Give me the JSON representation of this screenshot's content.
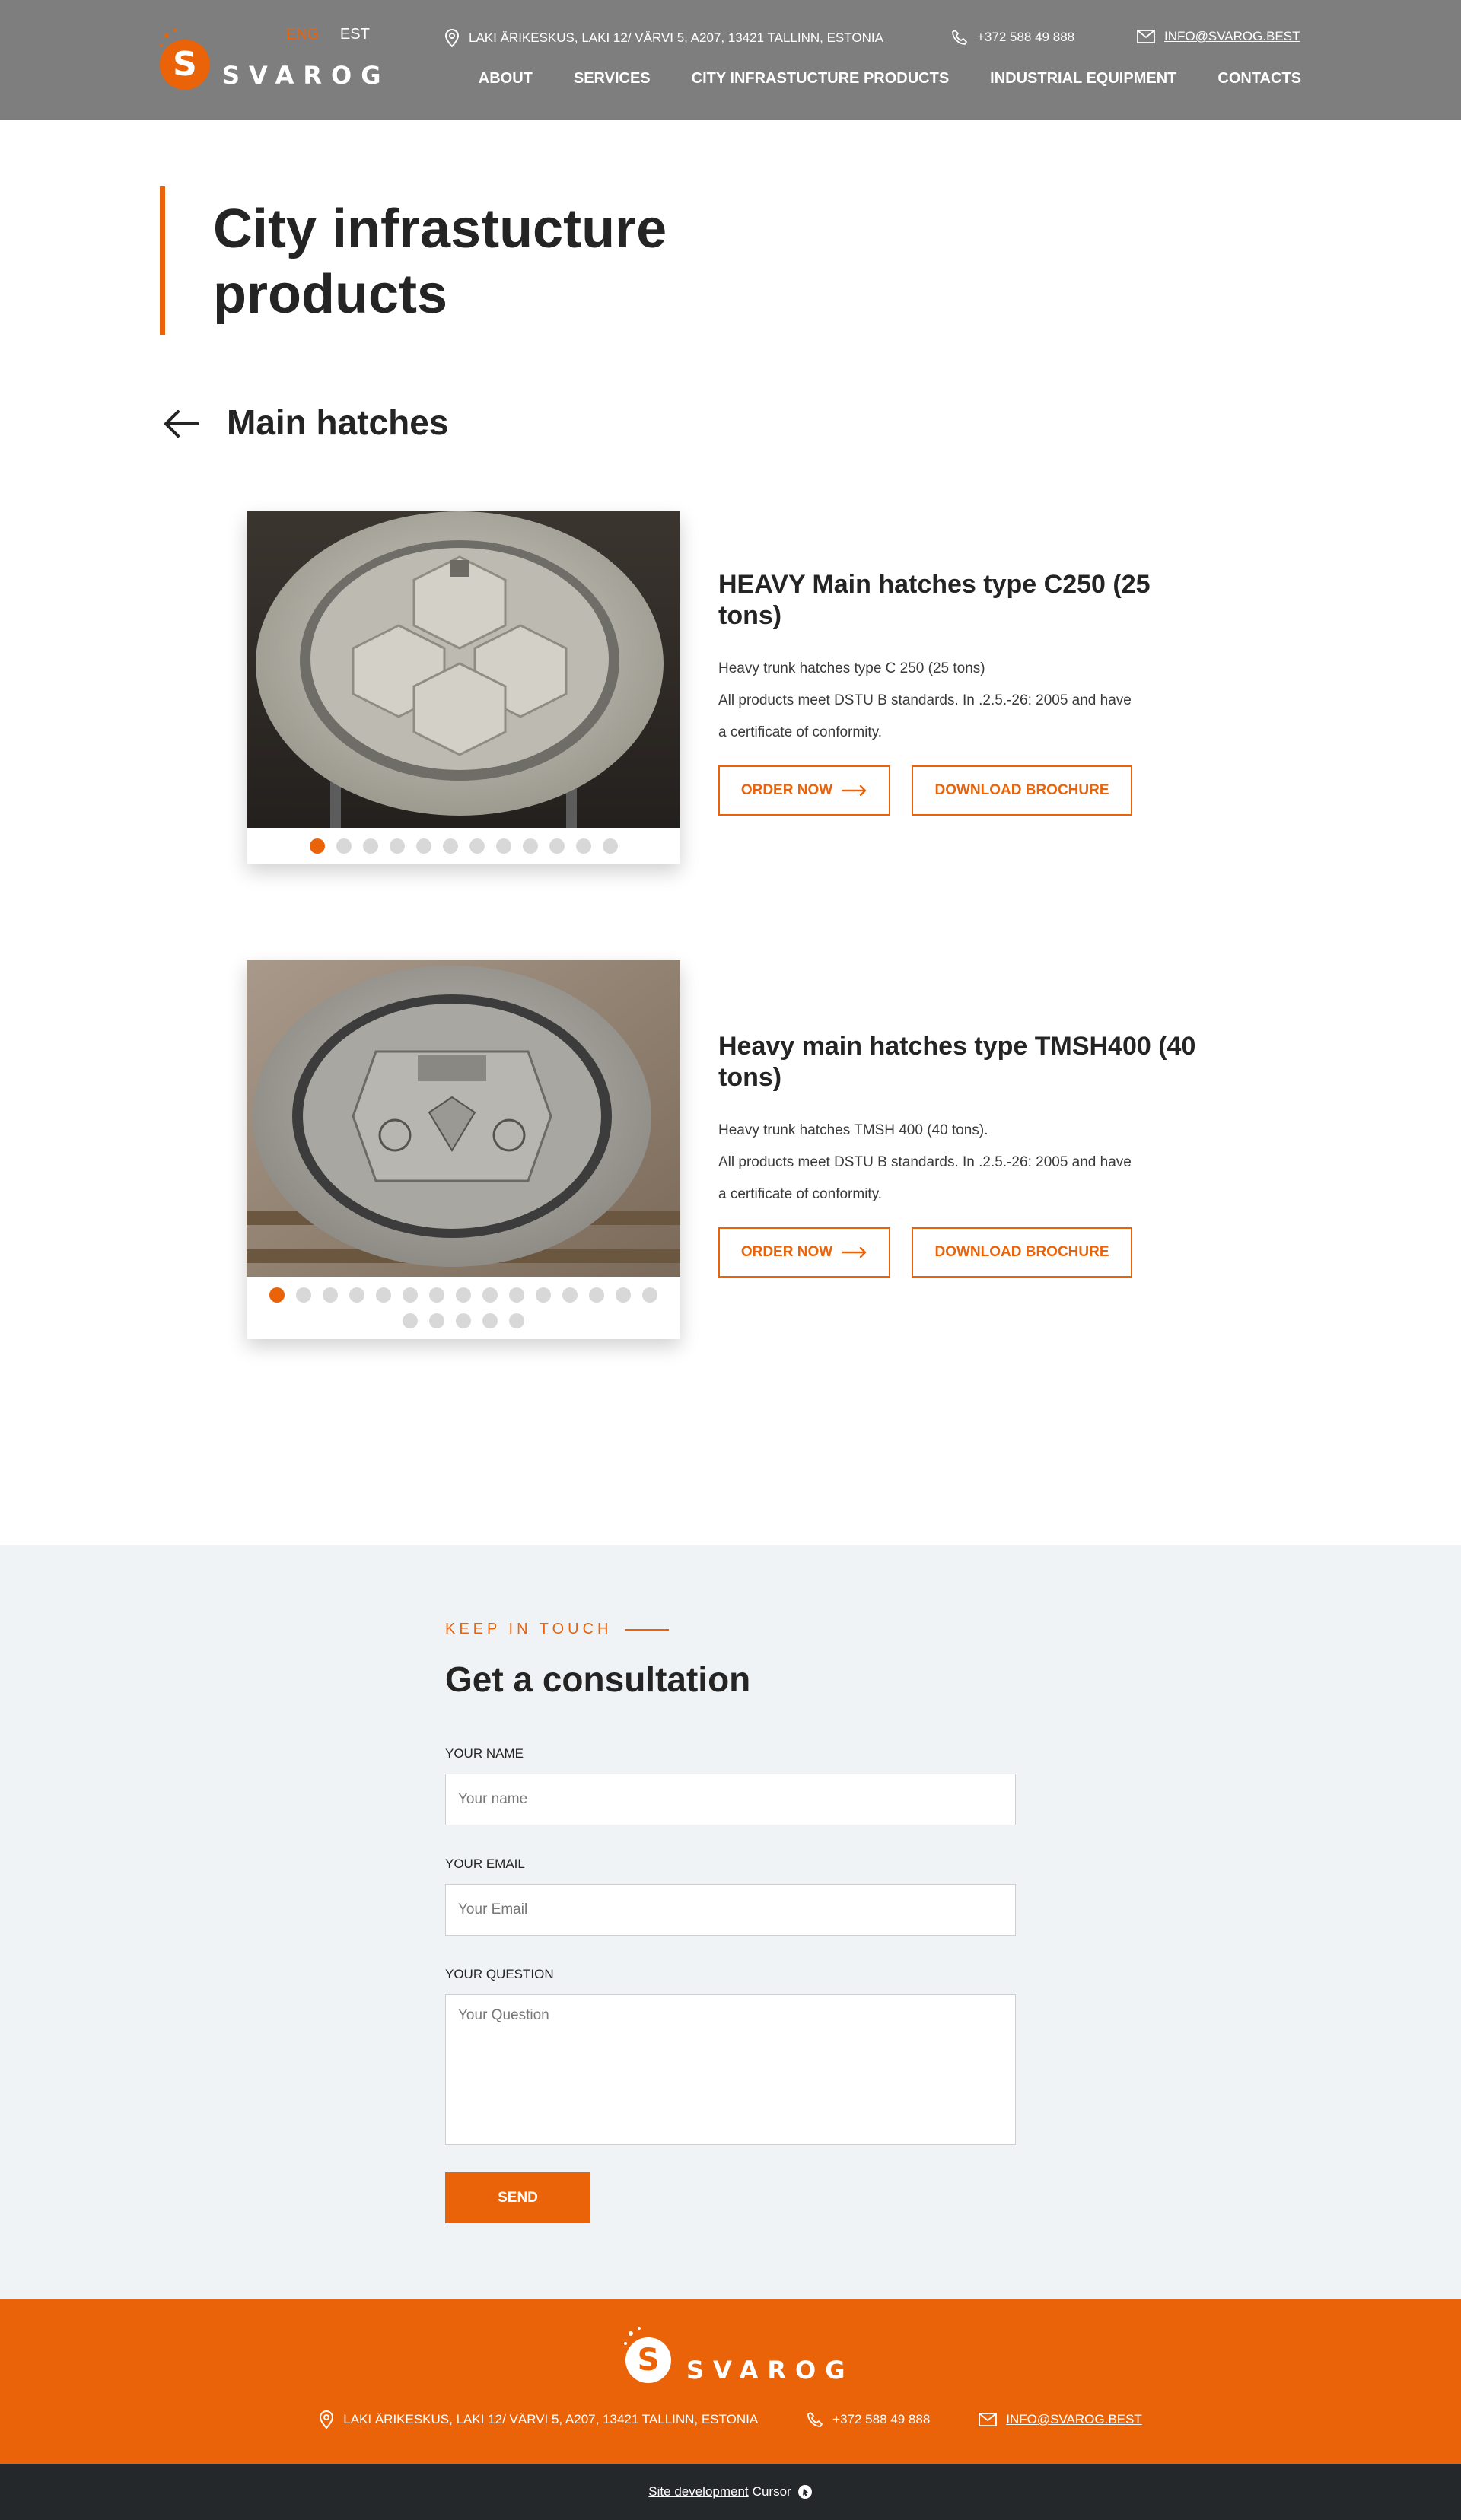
{
  "header": {
    "logo_text": "SVAROG",
    "languages": [
      {
        "label": "ENG",
        "active": true
      },
      {
        "label": "EST",
        "active": false
      }
    ],
    "address": "LAKI ÄRIKESKUS, LAKI 12/ VÄRVI 5, A207, 13421 TALLINN, ESTONIA",
    "phone": "+372 588 49 888",
    "email": "INFO@SVAROG.BEST",
    "nav": [
      "ABOUT",
      "SERVICES",
      "CITY INFRASTUCTURE PRODUCTS",
      "INDUSTRIAL EQUIPMENT",
      "CONTACTS"
    ]
  },
  "page": {
    "title": "City infrastucture products",
    "section_title": "Main hatches"
  },
  "products": [
    {
      "title": "HEAVY Main hatches type C250 (25 tons)",
      "desc_lines": [
        "Heavy trunk hatches type C 250 (25 tons)",
        "All products meet DSTU B standards. In .2.5.-26: 2005 and have",
        "a certificate of conformity."
      ],
      "order_label": "ORDER NOW",
      "brochure_label": "DOWNLOAD BROCHURE",
      "slide_count": 12,
      "active_slide": 1
    },
    {
      "title": "Heavy main hatches type TMSH400 (40 tons)",
      "desc_lines": [
        "Heavy trunk hatches TMSH 400 (40 tons).",
        "All products meet DSTU B standards. In .2.5.-26: 2005 and have",
        "a certificate of conformity."
      ],
      "order_label": "ORDER NOW",
      "brochure_label": "DOWNLOAD BROCHURE",
      "slide_count": 20,
      "active_slide": 1
    }
  ],
  "consultation": {
    "kicker": "KEEP IN TOUCH",
    "title": "Get a consultation",
    "name_label": "YOUR NAME",
    "name_placeholder": "Your name",
    "email_label": "YOUR EMAIL",
    "email_placeholder": "Your Email",
    "question_label": "YOUR QUESTION",
    "question_placeholder": "Your Question",
    "send_label": "SEND"
  },
  "footer": {
    "logo_text": "SVAROG",
    "address": "LAKI ÄRIKESKUS, LAKI 12/ VÄRVI 5, A207, 13421 TALLINN, ESTONIA",
    "phone": "+372 588 49 888",
    "email": "INFO@SVAROG.BEST",
    "dev_link": "Site development",
    "dev_name": "Cursor"
  },
  "colors": {
    "accent": "#ea6309",
    "header_bg": "#7e7e7e",
    "form_bg": "#f0f3f5",
    "bottom_bar": "#25282b"
  },
  "icons": [
    "location-pin-icon",
    "phone-icon",
    "mail-icon",
    "arrow-left-icon",
    "arrow-right-icon",
    "cursor-logo-icon"
  ]
}
